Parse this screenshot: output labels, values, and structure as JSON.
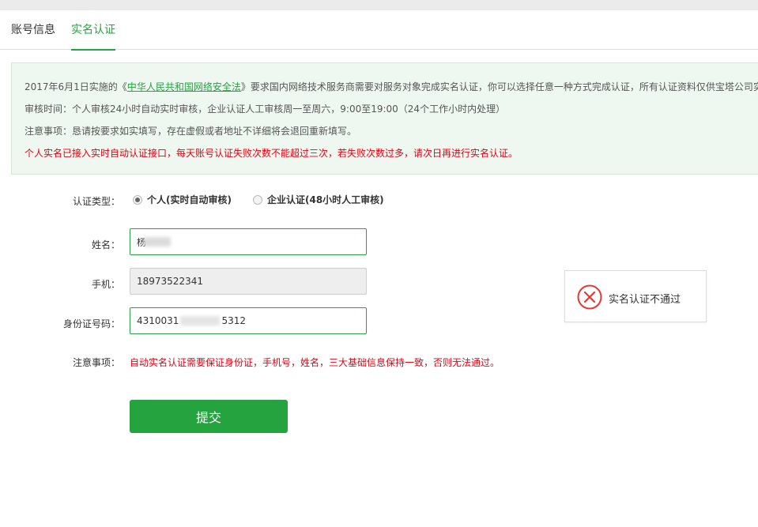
{
  "tabs": [
    {
      "label": "账号信息",
      "active": false
    },
    {
      "label": "实名认证",
      "active": true
    }
  ],
  "notice": {
    "line1_prefix": "2017年6月1日实施的《",
    "law_link": "中华人民共和国网络安全法",
    "line1_suffix": "》要求国内网络技术服务商需要对服务对象完成实名认证，你可以选择任意一种方式完成认证，所有认证资料仅供宝塔公司实",
    "line2": "审核时间：个人审核24小时自动实时审核，企业认证人工审核周一至周六，9:00至19:00（24个工作小时内处理）",
    "line3": "注意事项：恳请按要求如实填写，存在虚假或者地址不详细将会退回重新填写。",
    "line4": "个人实名已接入实时自动认证接口，每天账号认证失败次数不能超过三次，若失败次数过多，请次日再进行实名认证。"
  },
  "form": {
    "type_label": "认证类型：",
    "type_options": [
      {
        "label": "个人(实时自动审核)",
        "checked": true
      },
      {
        "label": "企业认证(48小时人工审核)",
        "checked": false
      }
    ],
    "name_label": "姓名：",
    "name_value": "杨",
    "phone_label": "手机：",
    "phone_value": "18973522341",
    "id_label": "身份证号码：",
    "id_value_prefix": "4310031",
    "id_value_suffix": "5312",
    "note_label": "注意事项：",
    "note_text": "自动实名认证需要保证身份证，手机号，姓名，三大基础信息保持一致，否则无法通过。",
    "submit_label": "提交"
  },
  "toast": {
    "icon": "error-x-icon",
    "message": "实名认证不通过"
  },
  "colors": {
    "accent": "#24a33f",
    "error": "#e60012",
    "notice_bg": "#eef8f0"
  }
}
